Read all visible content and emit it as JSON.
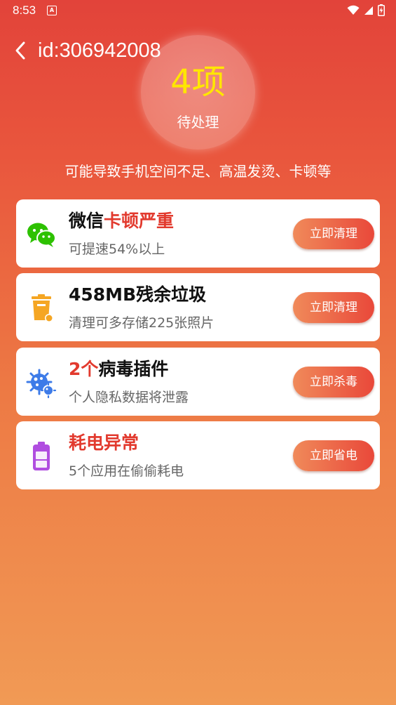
{
  "status_bar": {
    "time": "8:53",
    "app_icon_letter": "A",
    "icons": [
      "wifi-icon",
      "signal-icon",
      "battery-charging-icon"
    ]
  },
  "header": {
    "title": "id:306942008"
  },
  "summary": {
    "count": "4项",
    "label": "待处理",
    "warning": "可能导致手机空间不足、高温发烫、卡顿等"
  },
  "cards": [
    {
      "icon": "wechat-icon",
      "title_black": "微信",
      "title_red": "卡顿严重",
      "subtitle": "可提速54%以上",
      "button": "立即清理"
    },
    {
      "icon": "trash-bin-icon",
      "title_red": "",
      "title_black": "458MB残余垃圾",
      "subtitle": "清理可多存储225张照片",
      "button": "立即清理"
    },
    {
      "icon": "virus-icon",
      "title_red": "2个",
      "title_black": "病毒插件",
      "subtitle": "个人隐私数据将泄露",
      "button": "立即杀毒"
    },
    {
      "icon": "battery-icon",
      "title_red": "耗电异常",
      "title_black": "",
      "subtitle": "5个应用在偷偷耗电",
      "button": "立即省电"
    }
  ],
  "colors": {
    "accent_red": "#e23a2e",
    "badge_yellow": "#ffe600",
    "wechat_green": "#2dc100",
    "trash_orange": "#f5a623",
    "virus_blue": "#3d7be8",
    "battery_purple": "#b04de0"
  }
}
